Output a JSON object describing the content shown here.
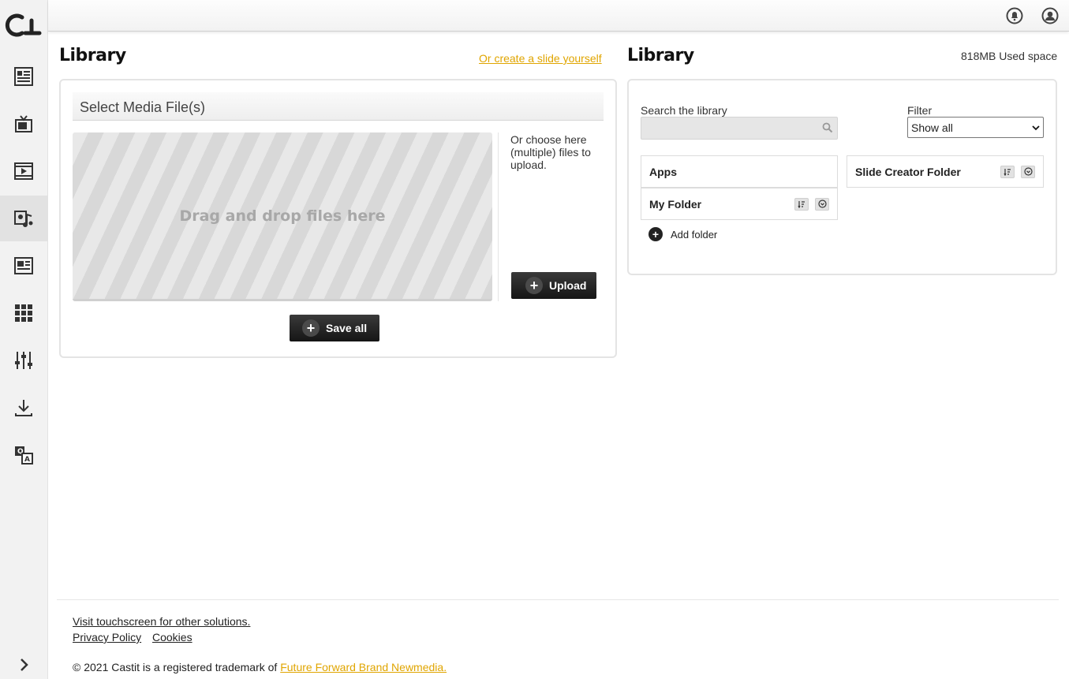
{
  "sidebar": {
    "logo": "castit-logo",
    "items": [
      {
        "icon": "newsfeed-icon"
      },
      {
        "icon": "tv-icon"
      },
      {
        "icon": "video-icon"
      },
      {
        "icon": "media-library-icon",
        "active": true
      },
      {
        "icon": "layout-icon"
      },
      {
        "icon": "apps-grid-icon"
      },
      {
        "icon": "sliders-icon"
      },
      {
        "icon": "download-icon"
      },
      {
        "icon": "translate-icon"
      }
    ],
    "expand_icon": "chevron-right-icon"
  },
  "topbar": {
    "notification_icon": "bell-icon",
    "user_icon": "user-icon"
  },
  "left": {
    "title": "Library",
    "create_link": "Or create a slide yourself",
    "media_header": "Select Media File(s)",
    "dropzone_text": "Drag and drop files here",
    "choose_text": "Or choose here (multiple) files to upload.",
    "upload_label": "Upload",
    "save_all_label": "Save all"
  },
  "right": {
    "title": "Library",
    "used_space": "818MB Used space",
    "search_label": "Search the library",
    "search_value": "",
    "filter_label": "Filter",
    "filter_value": "Show all",
    "folders": {
      "apps": "Apps",
      "my_folder": "My Folder",
      "slide_creator": "Slide Creator Folder"
    },
    "add_folder": "Add folder"
  },
  "footer": {
    "visit_link": "Visit touchscreen for other solutions.",
    "privacy_link": "Privacy Policy",
    "cookies_link": "Cookies",
    "copyright": "© 2021 Castit is a registered trademark of",
    "company_link": "Future Forward Brand Newmedia."
  },
  "colors": {
    "accent": "#e0a500",
    "dark_button": "#1f1f1f"
  }
}
